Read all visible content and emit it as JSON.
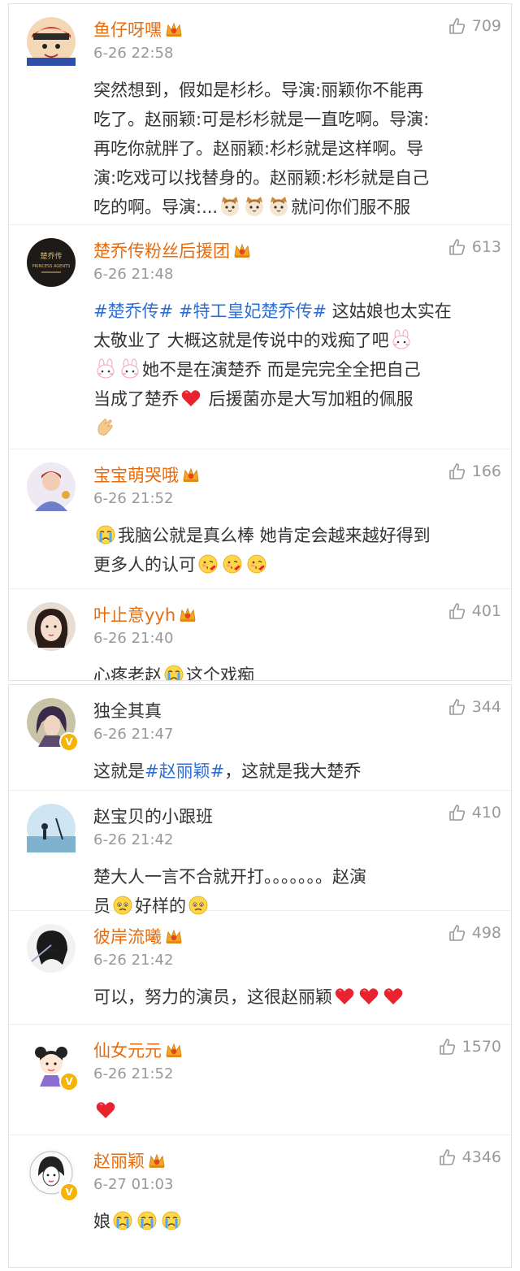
{
  "comments_top": [
    {
      "user": "鱼仔呀嘿",
      "vip": true,
      "time": "6-26 22:58",
      "likes": "709",
      "avatar_icon": "cartoon-boy-avatar",
      "body": [
        {
          "t": "text",
          "v": "突然想到，假如是杉杉。导演:丽颖你不能再"
        },
        {
          "t": "br"
        },
        {
          "t": "text",
          "v": "吃了。赵丽颖:可是杉杉就是一直吃啊。导演:"
        },
        {
          "t": "br"
        },
        {
          "t": "text",
          "v": "再吃你就胖了。赵丽颖:杉杉就是这样啊。导"
        },
        {
          "t": "br"
        },
        {
          "t": "text",
          "v": "演:吃戏可以找替身的。赵丽颖:杉杉就是自己"
        },
        {
          "t": "br"
        },
        {
          "t": "text",
          "v": "吃的啊。导演:..."
        },
        {
          "t": "emo",
          "v": "cat"
        },
        {
          "t": "emo",
          "v": "cat"
        },
        {
          "t": "emo",
          "v": "cat"
        },
        {
          "t": "text",
          "v": "就问你们服不服"
        }
      ]
    },
    {
      "user": "楚乔传粉丝后援团",
      "vip": true,
      "time": "6-26 21:48",
      "likes": "613",
      "avatar_icon": "fanclub-logo-avatar",
      "body": [
        {
          "t": "tag",
          "v": "#楚乔传#"
        },
        {
          "t": "text",
          "v": " "
        },
        {
          "t": "tag",
          "v": "#特工皇妃楚乔传#"
        },
        {
          "t": "text",
          "v": " 这姑娘也太实在"
        },
        {
          "t": "br"
        },
        {
          "t": "text",
          "v": "太敬业了 大概这就是传说中的戏痴了吧"
        },
        {
          "t": "emo",
          "v": "bunny"
        },
        {
          "t": "br"
        },
        {
          "t": "emo",
          "v": "bunny"
        },
        {
          "t": "emo",
          "v": "bunny"
        },
        {
          "t": "text",
          "v": "她不是在演楚乔 而是完完全全把自己"
        },
        {
          "t": "br"
        },
        {
          "t": "text",
          "v": "当成了楚乔"
        },
        {
          "t": "emo",
          "v": "heart"
        },
        {
          "t": "text",
          "v": " 后援菌亦是大写加粗的佩服"
        },
        {
          "t": "br"
        },
        {
          "t": "emo",
          "v": "clap"
        }
      ]
    },
    {
      "user": "宝宝萌哭哦",
      "vip": true,
      "time": "6-26 21:52",
      "likes": "166",
      "avatar_icon": "woman-avatar",
      "body": [
        {
          "t": "emo",
          "v": "cry"
        },
        {
          "t": "text",
          "v": "我脑公就是真么棒 她肯定会越来越好得到"
        },
        {
          "t": "br"
        },
        {
          "t": "text",
          "v": "更多人的认可"
        },
        {
          "t": "emo",
          "v": "kiss"
        },
        {
          "t": "emo",
          "v": "kiss"
        },
        {
          "t": "emo",
          "v": "kiss"
        }
      ]
    },
    {
      "user": "叶止意yyh",
      "vip": true,
      "time": "6-26 21:40",
      "likes": "401",
      "avatar_icon": "girl-avatar",
      "body": [
        {
          "t": "text",
          "v": "心疼老赵"
        },
        {
          "t": "emo",
          "v": "cry"
        },
        {
          "t": "text",
          "v": "这个戏痴"
        }
      ]
    }
  ],
  "comments_bottom": [
    {
      "user": "独全其真",
      "vip": false,
      "verified": true,
      "time": "6-26 21:47",
      "likes": "344",
      "avatar_icon": "anime-character-avatar",
      "body": [
        {
          "t": "text",
          "v": "这就是"
        },
        {
          "t": "tag",
          "v": "#赵丽颖#"
        },
        {
          "t": "text",
          "v": "，这就是我大楚乔"
        }
      ]
    },
    {
      "user": "赵宝贝的小跟班",
      "vip": false,
      "time": "6-26 21:42",
      "likes": "410",
      "avatar_icon": "silhouette-avatar",
      "body": [
        {
          "t": "text",
          "v": "楚大人一言不合就开打。。。。。。。赵演"
        },
        {
          "t": "br"
        },
        {
          "t": "text",
          "v": "员"
        },
        {
          "t": "emo",
          "v": "pout"
        },
        {
          "t": "text",
          "v": "好样的"
        },
        {
          "t": "emo",
          "v": "pout"
        }
      ]
    },
    {
      "user": "彼岸流曦",
      "vip": true,
      "time": "6-26 21:42",
      "likes": "498",
      "avatar_icon": "sketch-girl-avatar",
      "body": [
        {
          "t": "text",
          "v": "可以，努力的演员，这很赵丽颖"
        },
        {
          "t": "emo",
          "v": "heart"
        },
        {
          "t": "emo",
          "v": "heart"
        },
        {
          "t": "emo",
          "v": "heart"
        }
      ]
    },
    {
      "user": "仙女元元",
      "vip": true,
      "verified": true,
      "time": "6-26 21:52",
      "likes": "1570",
      "avatar_icon": "cartoon-girl-avatar",
      "body": [
        {
          "t": "emo",
          "v": "heart"
        }
      ]
    },
    {
      "user": "赵丽颖",
      "vip": true,
      "verified": true,
      "time": "6-27 01:03",
      "likes": "4346",
      "avatar_icon": "drawn-portrait-avatar",
      "body": [
        {
          "t": "text",
          "v": "娘"
        },
        {
          "t": "emo",
          "v": "cry"
        },
        {
          "t": "emo",
          "v": "cry"
        },
        {
          "t": "emo",
          "v": "cry"
        }
      ]
    }
  ],
  "colors": {
    "username_vip": "#e86b0e",
    "username_plain": "#333333",
    "hashtag": "#2d6fd6",
    "meta": "#999999",
    "badge": "#f6b300"
  }
}
